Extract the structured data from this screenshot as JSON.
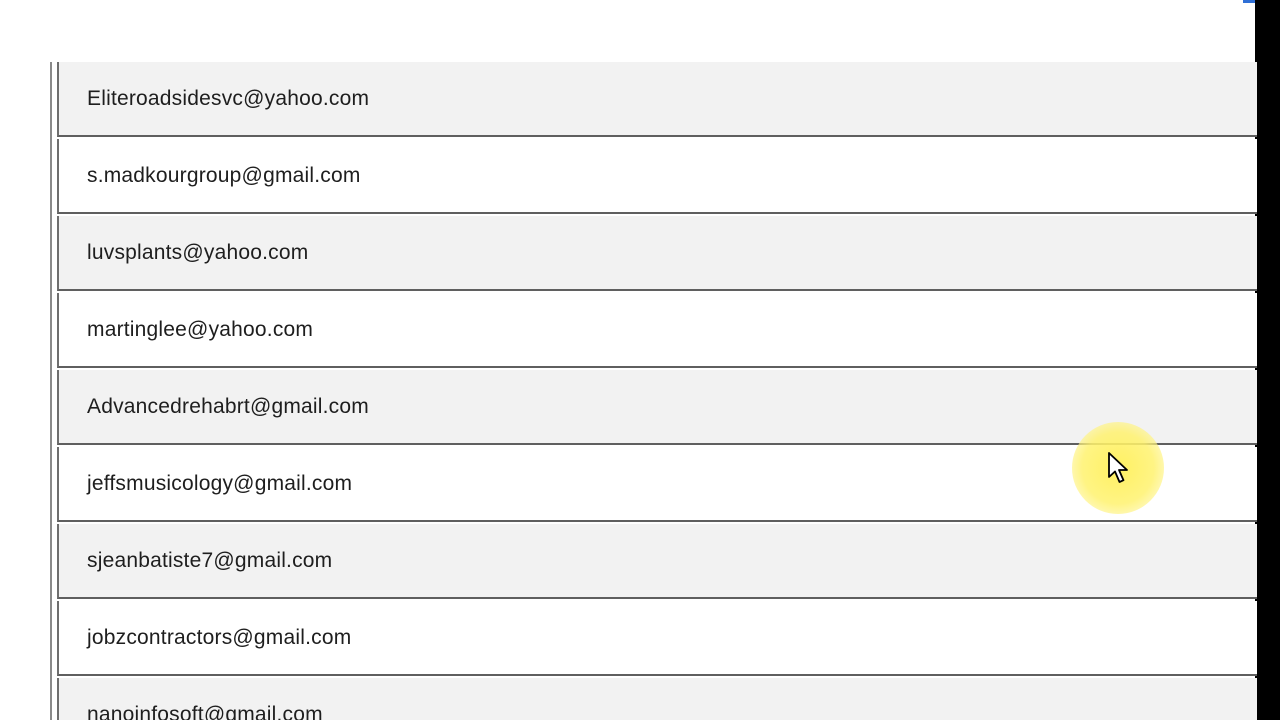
{
  "emails": [
    {
      "address": "Eliteroadsidesvc@yahoo.com"
    },
    {
      "address": "s.madkourgroup@gmail.com"
    },
    {
      "address": "luvsplants@yahoo.com"
    },
    {
      "address": "martinglee@yahoo.com"
    },
    {
      "address": "Advancedrehabrt@gmail.com"
    },
    {
      "address": "jeffsmusicology@gmail.com"
    },
    {
      "address": "sjeanbatiste7@gmail.com"
    },
    {
      "address": "jobzcontractors@gmail.com"
    },
    {
      "address": "nanoinfosoft@gmail.com"
    }
  ],
  "colors": {
    "row_shade": "#f2f2f2",
    "row_plain": "#ffffff",
    "text": "#1e1e1e",
    "cursor_highlight": "#fff15a"
  },
  "icons": {
    "cursor": "mouse-pointer-icon"
  }
}
